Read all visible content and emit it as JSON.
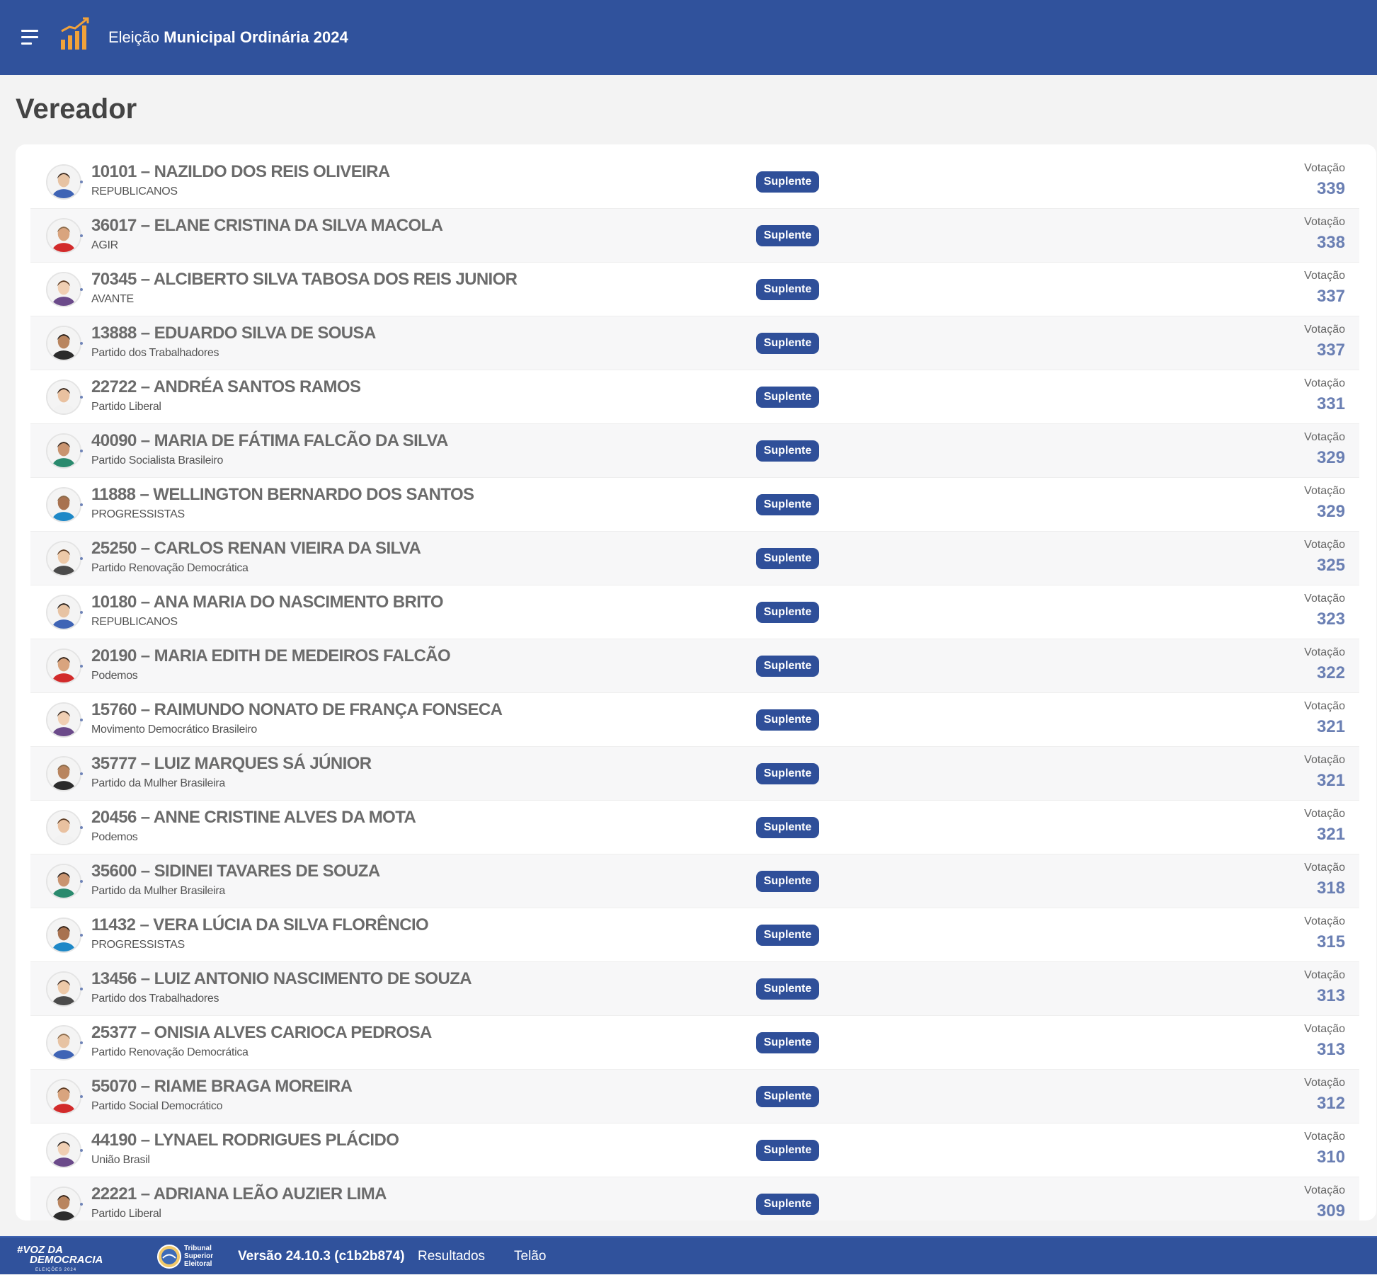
{
  "header": {
    "title_prefix": "Eleição",
    "title_main": "Municipal Ordinária 2024"
  },
  "page": {
    "title": "Vereador"
  },
  "candidates": [
    {
      "name": "10101 – NAZILDO DOS REIS OLIVEIRA",
      "party": "REPUBLICANOS",
      "status": "Suplente",
      "votes_label": "Votação",
      "votes": "339"
    },
    {
      "name": "36017 – ELANE CRISTINA DA SILVA MACOLA",
      "party": "AGIR",
      "status": "Suplente",
      "votes_label": "Votação",
      "votes": "338"
    },
    {
      "name": "70345 – ALCIBERTO SILVA TABOSA DOS REIS JUNIOR",
      "party": "AVANTE",
      "status": "Suplente",
      "votes_label": "Votação",
      "votes": "337"
    },
    {
      "name": "13888 – EDUARDO SILVA DE SOUSA",
      "party": "Partido dos Trabalhadores",
      "status": "Suplente",
      "votes_label": "Votação",
      "votes": "337"
    },
    {
      "name": "22722 – ANDRÉA SANTOS RAMOS",
      "party": "Partido Liberal",
      "status": "Suplente",
      "votes_label": "Votação",
      "votes": "331"
    },
    {
      "name": "40090 – MARIA DE FÁTIMA FALCÃO DA SILVA",
      "party": "Partido Socialista Brasileiro",
      "status": "Suplente",
      "votes_label": "Votação",
      "votes": "329"
    },
    {
      "name": "11888 – WELLINGTON BERNARDO DOS SANTOS",
      "party": "PROGRESSISTAS",
      "status": "Suplente",
      "votes_label": "Votação",
      "votes": "329"
    },
    {
      "name": "25250 – CARLOS RENAN VIEIRA DA SILVA",
      "party": "Partido Renovação Democrática",
      "status": "Suplente",
      "votes_label": "Votação",
      "votes": "325"
    },
    {
      "name": "10180 – ANA MARIA DO NASCIMENTO BRITO",
      "party": "REPUBLICANOS",
      "status": "Suplente",
      "votes_label": "Votação",
      "votes": "323"
    },
    {
      "name": "20190 – MARIA EDITH DE MEDEIROS FALCÃO",
      "party": "Podemos",
      "status": "Suplente",
      "votes_label": "Votação",
      "votes": "322"
    },
    {
      "name": "15760 – RAIMUNDO NONATO DE FRANÇA FONSECA",
      "party": "Movimento Democrático Brasileiro",
      "status": "Suplente",
      "votes_label": "Votação",
      "votes": "321"
    },
    {
      "name": "35777 – LUIZ MARQUES SÁ JÚNIOR",
      "party": "Partido da Mulher Brasileira",
      "status": "Suplente",
      "votes_label": "Votação",
      "votes": "321"
    },
    {
      "name": "20456 – ANNE CRISTINE ALVES DA MOTA",
      "party": "Podemos",
      "status": "Suplente",
      "votes_label": "Votação",
      "votes": "321"
    },
    {
      "name": "35600 – SIDINEI TAVARES DE SOUZA",
      "party": "Partido da Mulher Brasileira",
      "status": "Suplente",
      "votes_label": "Votação",
      "votes": "318"
    },
    {
      "name": "11432 – VERA LÚCIA DA SILVA FLORÊNCIO",
      "party": "PROGRESSISTAS",
      "status": "Suplente",
      "votes_label": "Votação",
      "votes": "315"
    },
    {
      "name": "13456 – LUIZ ANTONIO NASCIMENTO DE SOUZA",
      "party": "Partido dos Trabalhadores",
      "status": "Suplente",
      "votes_label": "Votação",
      "votes": "313"
    },
    {
      "name": "25377 – ONISIA ALVES CARIOCA PEDROSA",
      "party": "Partido Renovação Democrática",
      "status": "Suplente",
      "votes_label": "Votação",
      "votes": "313"
    },
    {
      "name": "55070 – RIAME BRAGA MOREIRA",
      "party": "Partido Social Democrático",
      "status": "Suplente",
      "votes_label": "Votação",
      "votes": "312"
    },
    {
      "name": "44190 – LYNAEL RODRIGUES PLÁCIDO",
      "party": "União Brasil",
      "status": "Suplente",
      "votes_label": "Votação",
      "votes": "310"
    },
    {
      "name": "22221 – ADRIANA LEÃO AUZIER LIMA",
      "party": "Partido Liberal",
      "status": "Suplente",
      "votes_label": "Votação",
      "votes": "309"
    }
  ],
  "footer": {
    "brand_line1": "#VOZ DA",
    "brand_line2": "DEMOCRACIA",
    "brand_line3": "ELEIÇÕES 2024",
    "tse_line1": "Tribunal",
    "tse_line2": "Superior",
    "tse_line3": "Eleitoral",
    "version": "Versão 24.10.3 (c1b2b874)",
    "links": [
      "Resultados",
      "Telão"
    ]
  },
  "colors": {
    "brand": "#30529c",
    "badge": "#2f4f99",
    "votes": "#6a7fb3",
    "logo_accent": "#f1a23a"
  }
}
